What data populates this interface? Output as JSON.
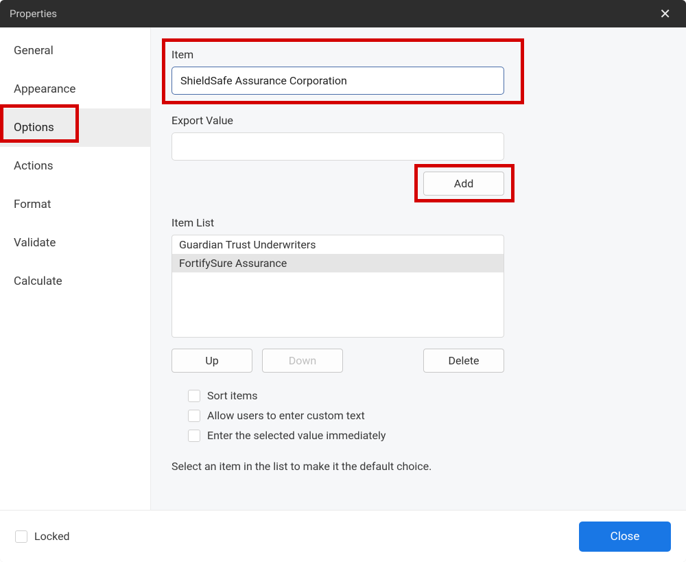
{
  "window": {
    "title": "Properties"
  },
  "sidebar": {
    "items": [
      {
        "label": "General"
      },
      {
        "label": "Appearance"
      },
      {
        "label": "Options",
        "active": true
      },
      {
        "label": "Actions"
      },
      {
        "label": "Format"
      },
      {
        "label": "Validate"
      },
      {
        "label": "Calculate"
      }
    ]
  },
  "main": {
    "item_label": "Item",
    "item_value": "ShieldSafe Assurance Corporation",
    "export_label": "Export Value",
    "export_value": "",
    "add_label": "Add",
    "item_list_label": "Item List",
    "item_list": [
      {
        "text": "Guardian Trust Underwriters",
        "selected": false
      },
      {
        "text": "FortifySure Assurance",
        "selected": true
      }
    ],
    "buttons": {
      "up": "Up",
      "down": "Down",
      "delete": "Delete"
    },
    "checks": {
      "sort": "Sort items",
      "custom": "Allow users to enter custom text",
      "immediate": "Enter the selected value immediately"
    },
    "hint": "Select an item in the list to make it the default choice."
  },
  "footer": {
    "locked_label": "Locked",
    "close_label": "Close"
  }
}
